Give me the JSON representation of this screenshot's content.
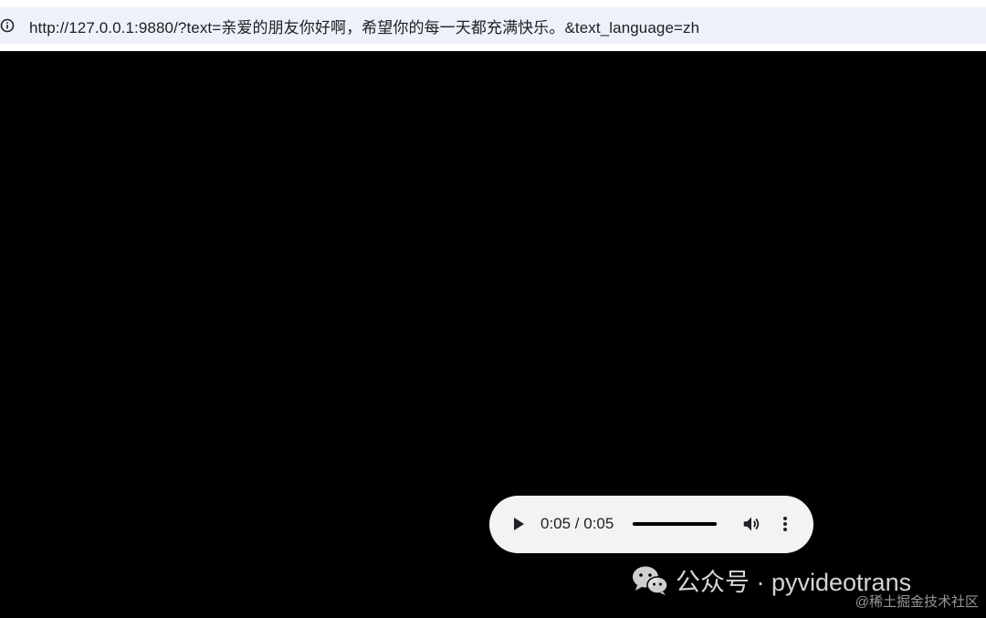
{
  "browser": {
    "url": "http://127.0.0.1:9880/?text=亲爱的朋友你好啊，希望你的每一天都充满快乐。&text_language=zh",
    "site_info_icon": "info-circle-icon"
  },
  "audio_player": {
    "time_display": "0:05 / 0:05",
    "progress_fraction": 1.0,
    "play_icon": "play-icon",
    "volume_icon": "volume-icon",
    "more_icon": "more-vert-icon"
  },
  "watermark": {
    "main": "公众号 · pyvideotrans",
    "sub": "@稀土掘金技术社区",
    "icon": "wechat-icon"
  }
}
